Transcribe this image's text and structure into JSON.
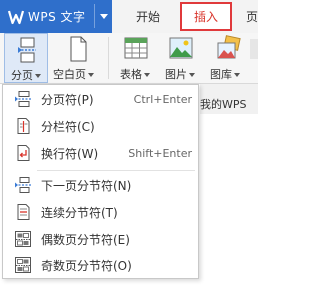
{
  "app": {
    "name": "WPS 文字"
  },
  "tabs": {
    "start": "开始",
    "insert": "插入",
    "next": "页"
  },
  "ribbon": {
    "page_break": "分页",
    "blank_page": "空白页",
    "table": "表格",
    "picture": "图片",
    "gallery": "图库"
  },
  "doc_tab": "我的WPS",
  "menu": {
    "items": [
      {
        "label": "分页符(P)",
        "shortcut": "Ctrl+Enter",
        "icon": "page-break-icon"
      },
      {
        "label": "分栏符(C)",
        "shortcut": "",
        "icon": "column-break-icon"
      },
      {
        "label": "换行符(W)",
        "shortcut": "Shift+Enter",
        "icon": "line-break-icon"
      },
      {
        "label": "下一页分节符(N)",
        "shortcut": "",
        "icon": "next-page-section-icon"
      },
      {
        "label": "连续分节符(T)",
        "shortcut": "",
        "icon": "continuous-section-icon"
      },
      {
        "label": "偶数页分节符(E)",
        "shortcut": "",
        "icon": "even-page-section-icon"
      },
      {
        "label": "奇数页分节符(O)",
        "shortcut": "",
        "icon": "odd-page-section-icon"
      }
    ]
  },
  "colors": {
    "app_blue": "#2f6fcb",
    "active_tab_red": "#e0393b",
    "accent_blue": "#3a7bd5"
  }
}
